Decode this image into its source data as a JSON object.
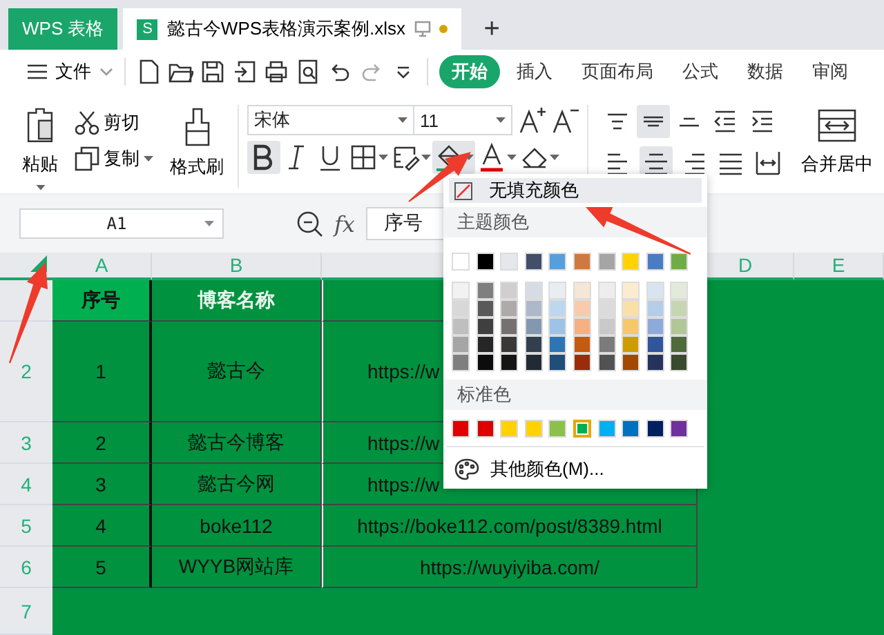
{
  "tabs": [
    {
      "label": "WPS 表格",
      "kind": "home"
    },
    {
      "label": "懿古今WPS表格演示案例.xlsx",
      "kind": "file",
      "badge": "S"
    }
  ],
  "new_tab": "+",
  "menu": {
    "file": "文件",
    "tabs": [
      {
        "label": "开始",
        "selected": true
      },
      {
        "label": "插入",
        "selected": false
      },
      {
        "label": "页面布局",
        "selected": false
      },
      {
        "label": "公式",
        "selected": false
      },
      {
        "label": "数据",
        "selected": false
      },
      {
        "label": "审阅",
        "selected": false
      }
    ]
  },
  "ribbon": {
    "paste": "粘贴",
    "cut": "剪切",
    "copy": "复制",
    "format_painter": "格式刷",
    "font_name": "宋体",
    "font_size": "11",
    "format_buttons": [
      {
        "kind": "bold",
        "pressed": true
      },
      {
        "kind": "italic",
        "pressed": false
      },
      {
        "kind": "underline",
        "pressed": false
      },
      {
        "kind": "border",
        "pressed": false
      },
      {
        "kind": "condition",
        "pressed": false
      },
      {
        "kind": "fill",
        "pressed": true
      },
      {
        "kind": "fontcolor",
        "pressed": false
      },
      {
        "kind": "eraser",
        "pressed": false
      }
    ],
    "align_top": [
      {
        "kind": "vtop",
        "pressed": false
      },
      {
        "kind": "vmid",
        "pressed": true
      },
      {
        "kind": "vbottom",
        "pressed": false
      },
      {
        "kind": "outdent",
        "pressed": false
      },
      {
        "kind": "indent",
        "pressed": false
      }
    ],
    "align_bottom": [
      {
        "kind": "left",
        "pressed": false
      },
      {
        "kind": "center",
        "pressed": true
      },
      {
        "kind": "right",
        "pressed": false
      },
      {
        "kind": "justify",
        "pressed": false
      },
      {
        "kind": "distributed",
        "pressed": false
      }
    ],
    "merge": "合并居中"
  },
  "formula_bar": {
    "cell": "A1",
    "fx": "fx",
    "value": "序号"
  },
  "columns": [
    {
      "label": "A"
    },
    {
      "label": "B"
    },
    {},
    {
      "label": "D"
    },
    {
      "label": "E"
    }
  ],
  "rows": [
    {
      "kind": "header",
      "cells": [
        {
          "text": "序号",
          "selected": true
        },
        {
          "text": "博客名称",
          "selected": false
        },
        {
          "selected": false
        }
      ]
    },
    {
      "number": "2",
      "kind": "data",
      "cells": [
        {
          "text": "1",
          "selected": false
        },
        {
          "text": "懿古今",
          "selected": false
        },
        {
          "text": "https://w",
          "selected": false,
          "covered": true
        }
      ]
    },
    {
      "number": "3",
      "kind": "data",
      "cells": [
        {
          "text": "2",
          "selected": false
        },
        {
          "text": "懿古今博客",
          "selected": false
        },
        {
          "text": "https://w",
          "selected": false,
          "covered": true
        }
      ]
    },
    {
      "number": "4",
      "kind": "data",
      "cells": [
        {
          "text": "3",
          "selected": false
        },
        {
          "text": "懿古今网",
          "selected": false
        },
        {
          "text": "https://w",
          "selected": false,
          "covered": true
        }
      ]
    },
    {
      "number": "5",
      "kind": "data",
      "cells": [
        {
          "text": "4",
          "selected": false
        },
        {
          "text": "boke112",
          "selected": false
        },
        {
          "text": "https://boke112.com/post/8389.html",
          "selected": false,
          "covered": false
        }
      ]
    },
    {
      "number": "6",
      "kind": "data",
      "cells": [
        {
          "text": "5",
          "selected": false
        },
        {
          "text": "WYYB网站库",
          "selected": false
        },
        {
          "text": "https://wuyiyiba.com/",
          "selected": false,
          "covered": false
        }
      ]
    },
    {
      "number": "7",
      "kind": "empty",
      "cells": []
    }
  ],
  "color_menu": {
    "no_fill": "无填充颜色",
    "theme_title": "主题颜色",
    "theme_colors": [
      {
        "color": "#ffffff"
      },
      {
        "color": "#000000"
      },
      {
        "color": "#e5e7ec"
      },
      {
        "color": "#434e68"
      },
      {
        "color": "#55a0dc"
      },
      {
        "color": "#cd7a40"
      },
      {
        "color": "#a5a5a5"
      },
      {
        "color": "#ffd200"
      },
      {
        "color": "#4a7cc4"
      },
      {
        "color": "#70ad47"
      }
    ],
    "theme_shades": [
      [
        {
          "color": "#f2f2f2"
        },
        {
          "color": "#7f7f7f"
        },
        {
          "color": "#d0cece"
        },
        {
          "color": "#d6dce4"
        },
        {
          "color": "#e8edf2"
        },
        {
          "color": "#f5e6d6"
        },
        {
          "color": "#ededed"
        },
        {
          "color": "#fbecd0"
        },
        {
          "color": "#dae3f0"
        },
        {
          "color": "#e2eadb"
        }
      ],
      [
        {
          "color": "#d8d8d8"
        },
        {
          "color": "#595959"
        },
        {
          "color": "#aeaaaa"
        },
        {
          "color": "#adb9ca"
        },
        {
          "color": "#bdd7ee"
        },
        {
          "color": "#f8cbad"
        },
        {
          "color": "#dbdbdb"
        },
        {
          "color": "#f9e0a6"
        },
        {
          "color": "#b4cde8"
        },
        {
          "color": "#c6d6b2"
        }
      ],
      [
        {
          "color": "#bfbfbf"
        },
        {
          "color": "#3f3f3f"
        },
        {
          "color": "#767171"
        },
        {
          "color": "#8497b0"
        },
        {
          "color": "#9dc3e6"
        },
        {
          "color": "#f4b183"
        },
        {
          "color": "#c9c9c9"
        },
        {
          "color": "#f5c96a"
        },
        {
          "color": "#8eaadb"
        },
        {
          "color": "#b3c697"
        }
      ],
      [
        {
          "color": "#a5a5a5"
        },
        {
          "color": "#262626"
        },
        {
          "color": "#3b3838"
        },
        {
          "color": "#323f4f"
        },
        {
          "color": "#2e75b6"
        },
        {
          "color": "#c55a11"
        },
        {
          "color": "#7b7b7b"
        },
        {
          "color": "#cc9d00"
        },
        {
          "color": "#2f559b"
        },
        {
          "color": "#516a3b"
        }
      ],
      [
        {
          "color": "#7f7f7f"
        },
        {
          "color": "#0c0c0c"
        },
        {
          "color": "#171414"
        },
        {
          "color": "#222a35"
        },
        {
          "color": "#1f4e79"
        },
        {
          "color": "#9a2c0b"
        },
        {
          "color": "#525252"
        },
        {
          "color": "#a34800"
        },
        {
          "color": "#26335d"
        },
        {
          "color": "#394a2d"
        }
      ]
    ],
    "standard_title": "标准色",
    "standard_colors": [
      {
        "color": "#e00000",
        "selected": false
      },
      {
        "color": "#dd0000",
        "selected": false
      },
      {
        "color": "#ffd200",
        "selected": false
      },
      {
        "color": "#ffd200",
        "selected": false
      },
      {
        "color": "#8bc14a",
        "selected": false
      },
      {
        "color": "#00b050",
        "selected": true
      },
      {
        "color": "#00b0f0",
        "selected": false
      },
      {
        "color": "#0070c0",
        "selected": false
      },
      {
        "color": "#002060",
        "selected": false
      },
      {
        "color": "#7030a0",
        "selected": false
      }
    ],
    "more_colors": "其他颜色(M)..."
  }
}
